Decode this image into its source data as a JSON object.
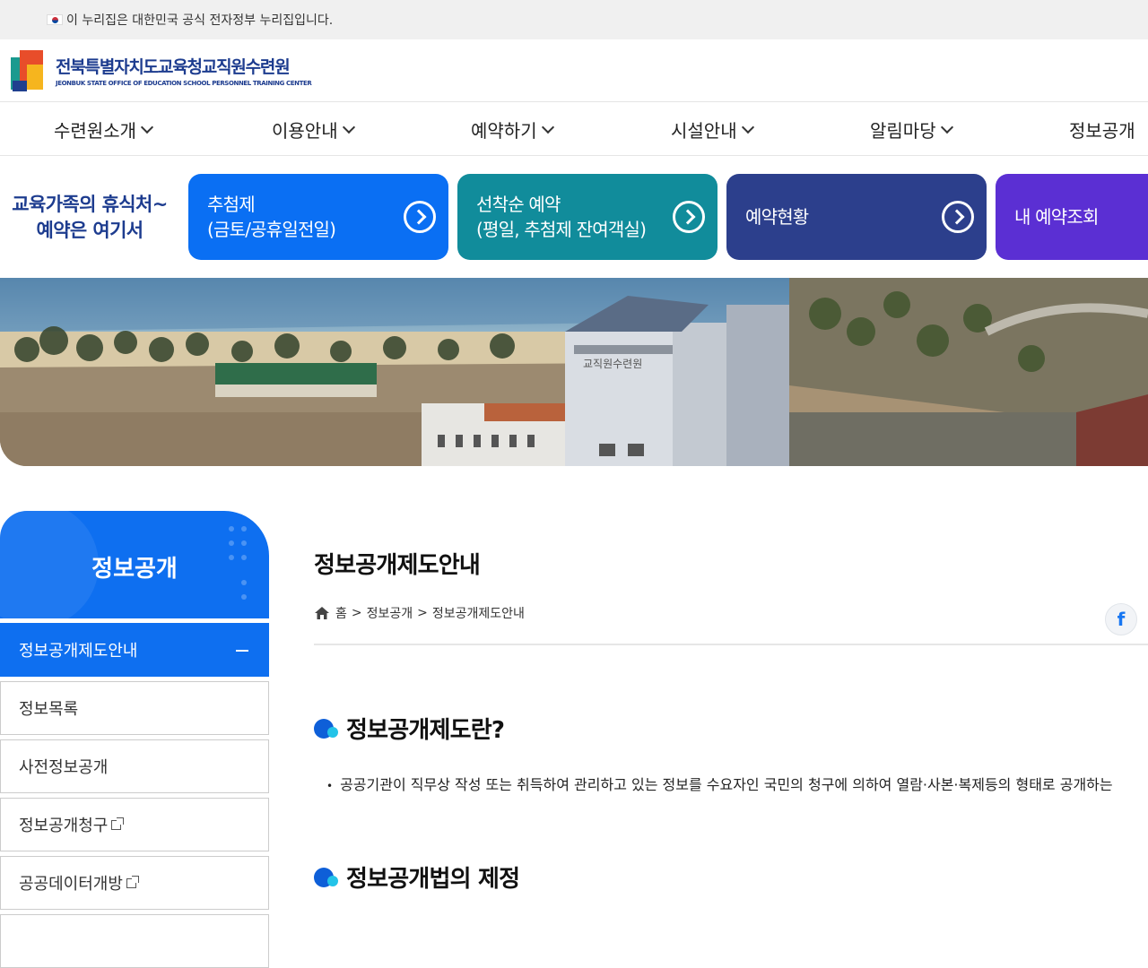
{
  "gov_bar": {
    "text": "이 누리집은 대한민국 공식 전자정부 누리집입니다."
  },
  "logo": {
    "ko": "전북특별자치도교육청교직원수련원",
    "en": "JEONBUK STATE OFFICE OF EDUCATION SCHOOL PERSONNEL TRAINING CENTER"
  },
  "nav": [
    "수련원소개",
    "이용안내",
    "예약하기",
    "시설안내",
    "알림마당",
    "정보공개"
  ],
  "quick": {
    "title_line1": "교육가족의 휴식처~",
    "title_line2": "예약은 여기서",
    "buttons": [
      {
        "line1": "추첨제",
        "line2": "(금토/공휴일전일)",
        "color": "#0a6ff3"
      },
      {
        "line1": "선착순 예약",
        "line2": "(평일, 추첨제 잔여객실)",
        "color": "#118c9b"
      },
      {
        "line1": "예약현황",
        "line2": "",
        "color": "#2c3f8c"
      },
      {
        "line1": "내 예약조회",
        "line2": "",
        "color": "#5b2fd3"
      }
    ]
  },
  "banner": {
    "building_sign": "교직원수련원"
  },
  "lnb": {
    "title": "정보공개",
    "items": [
      "정보공개제도안내",
      "정보목록",
      "사전정보공개",
      "정보공개청구",
      "공공데이터개방"
    ]
  },
  "content": {
    "page_title": "정보공개제도안내",
    "breadcrumb": [
      "홈",
      "정보공개",
      "정보공개제도안내"
    ],
    "share_fb": "f",
    "section1_title": "정보공개제도란?",
    "section1_text": "공공기관이 직무상 작성 또는 취득하여 관리하고 있는 정보를 수요자인 국민의 청구에 의하여 열람·사본·복제등의 형태로 공개하는",
    "section2_title": "정보공개법의 제정"
  }
}
